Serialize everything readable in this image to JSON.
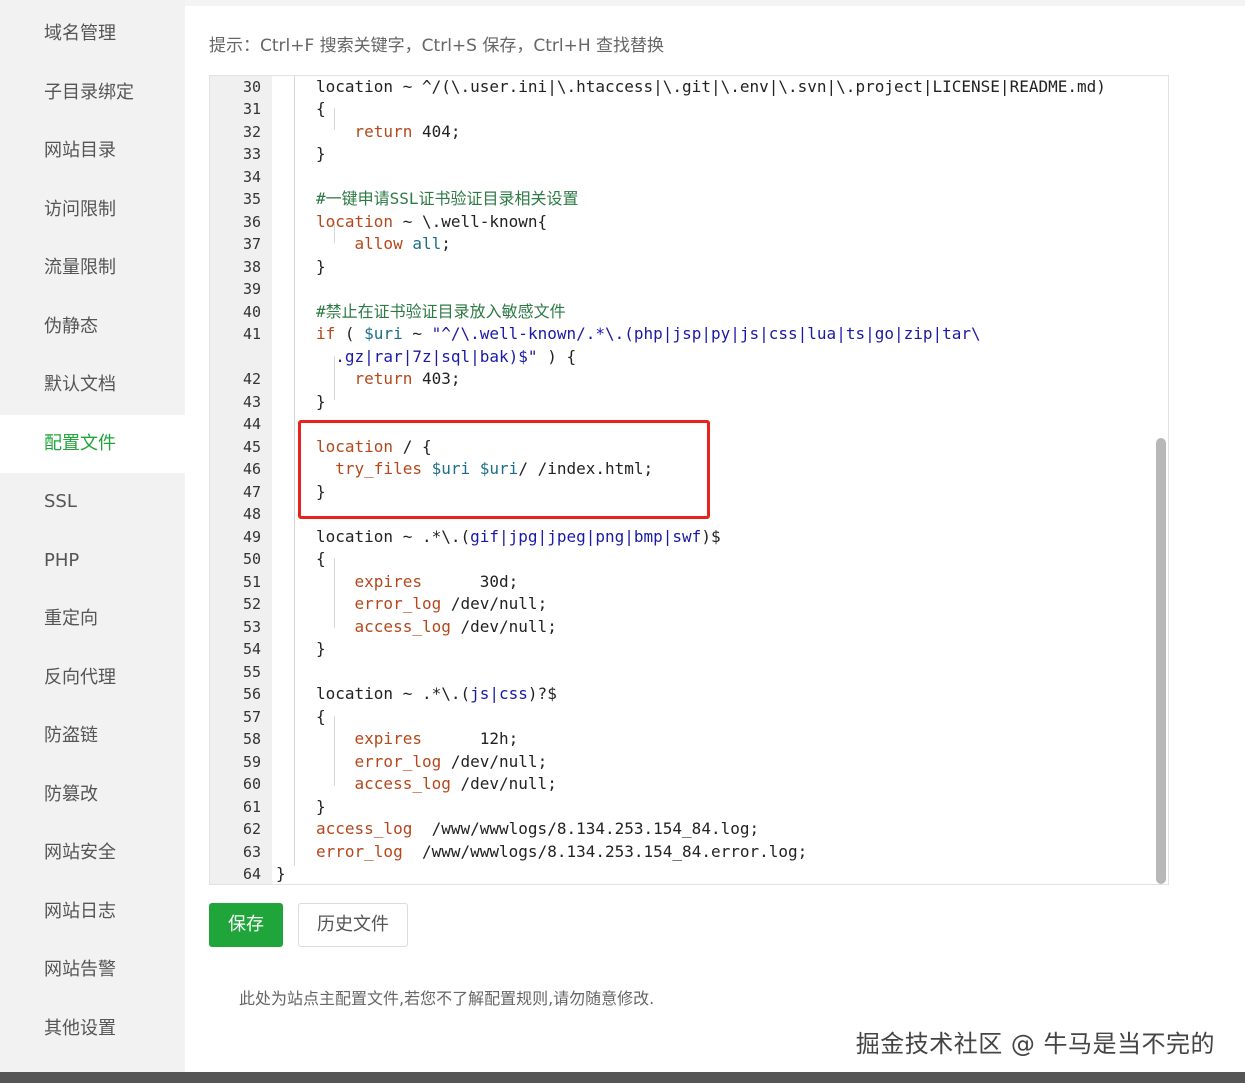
{
  "sidebar": {
    "items": [
      {
        "label": "域名管理"
      },
      {
        "label": "子目录绑定"
      },
      {
        "label": "网站目录"
      },
      {
        "label": "访问限制"
      },
      {
        "label": "流量限制"
      },
      {
        "label": "伪静态"
      },
      {
        "label": "默认文档"
      },
      {
        "label": "配置文件",
        "active": true
      },
      {
        "label": "SSL"
      },
      {
        "label": "PHP"
      },
      {
        "label": "重定向"
      },
      {
        "label": "反向代理"
      },
      {
        "label": "防盗链"
      },
      {
        "label": "防篡改"
      },
      {
        "label": "网站安全"
      },
      {
        "label": "网站日志"
      },
      {
        "label": "网站告警"
      },
      {
        "label": "其他设置"
      }
    ]
  },
  "hint": "提示：Ctrl+F 搜索关键字，Ctrl+S 保存，Ctrl+H 查找替换",
  "editor": {
    "lines": [
      {
        "n": "30",
        "code": [
          [
            "plain",
            "location ~ ^/(\\.user.ini|\\.htaccess|\\.git|\\.env|\\.svn|\\.project|LICENSE|README.md)"
          ]
        ]
      },
      {
        "n": "31",
        "code": [
          [
            "plain",
            "{"
          ]
        ]
      },
      {
        "n": "32",
        "code": [
          [
            "plain",
            "    "
          ],
          [
            "kw",
            "return"
          ],
          [
            "plain",
            " 404;"
          ]
        ]
      },
      {
        "n": "33",
        "code": [
          [
            "plain",
            "}"
          ]
        ]
      },
      {
        "n": "34",
        "code": []
      },
      {
        "n": "35",
        "code": [
          [
            "cm",
            "#一键申请SSL证书验证目录相关设置"
          ]
        ]
      },
      {
        "n": "36",
        "code": [
          [
            "kw",
            "location"
          ],
          [
            "plain",
            " ~ \\.well-known{"
          ]
        ]
      },
      {
        "n": "37",
        "code": [
          [
            "plain",
            "    "
          ],
          [
            "kw",
            "allow"
          ],
          [
            "plain",
            " "
          ],
          [
            "var",
            "all"
          ],
          [
            "plain",
            ";"
          ]
        ]
      },
      {
        "n": "38",
        "code": [
          [
            "plain",
            "}"
          ]
        ]
      },
      {
        "n": "39",
        "code": []
      },
      {
        "n": "40",
        "code": [
          [
            "cm",
            "#禁止在证书验证目录放入敏感文件"
          ]
        ]
      },
      {
        "n": "41",
        "code": [
          [
            "kw",
            "if"
          ],
          [
            "plain",
            " ( "
          ],
          [
            "var",
            "$uri"
          ],
          [
            "plain",
            " ~ "
          ],
          [
            "str",
            "\"^/\\.well-known/.*\\.(php|jsp|py|js|css|lua|ts|go|zip|tar\\"
          ]
        ]
      },
      {
        "n": "",
        "code": [
          [
            "str",
            "  .gz|rar|7z|sql|bak)$\""
          ],
          [
            "plain",
            " ) {"
          ]
        ]
      },
      {
        "n": "42",
        "code": [
          [
            "plain",
            "    "
          ],
          [
            "kw",
            "return"
          ],
          [
            "plain",
            " 403;"
          ]
        ]
      },
      {
        "n": "43",
        "code": [
          [
            "plain",
            "}"
          ]
        ]
      },
      {
        "n": "44",
        "code": []
      },
      {
        "n": "45",
        "code": [
          [
            "kw",
            "location"
          ],
          [
            "plain",
            " / {"
          ]
        ]
      },
      {
        "n": "46",
        "code": [
          [
            "plain",
            "  "
          ],
          [
            "kw",
            "try_files"
          ],
          [
            "plain",
            " "
          ],
          [
            "var",
            "$uri"
          ],
          [
            "plain",
            " "
          ],
          [
            "var",
            "$uri"
          ],
          [
            "plain",
            "/ /index.html;"
          ]
        ]
      },
      {
        "n": "47",
        "code": [
          [
            "plain",
            "}"
          ]
        ]
      },
      {
        "n": "48",
        "code": []
      },
      {
        "n": "49",
        "code": [
          [
            "plain",
            "location ~ .*\\.("
          ],
          [
            "str",
            "gif|jpg|jpeg|png|bmp|swf"
          ],
          [
            "plain",
            ")$"
          ]
        ]
      },
      {
        "n": "50",
        "code": [
          [
            "plain",
            "{"
          ]
        ]
      },
      {
        "n": "51",
        "code": [
          [
            "plain",
            "    "
          ],
          [
            "kw",
            "expires"
          ],
          [
            "plain",
            "      30d;"
          ]
        ]
      },
      {
        "n": "52",
        "code": [
          [
            "plain",
            "    "
          ],
          [
            "kw",
            "error_log"
          ],
          [
            "plain",
            " /dev/null;"
          ]
        ]
      },
      {
        "n": "53",
        "code": [
          [
            "plain",
            "    "
          ],
          [
            "kw",
            "access_log"
          ],
          [
            "plain",
            " /dev/null;"
          ]
        ]
      },
      {
        "n": "54",
        "code": [
          [
            "plain",
            "}"
          ]
        ]
      },
      {
        "n": "55",
        "code": []
      },
      {
        "n": "56",
        "code": [
          [
            "plain",
            "location ~ .*\\.("
          ],
          [
            "str",
            "js|css"
          ],
          [
            "plain",
            ")?$"
          ]
        ]
      },
      {
        "n": "57",
        "code": [
          [
            "plain",
            "{"
          ]
        ]
      },
      {
        "n": "58",
        "code": [
          [
            "plain",
            "    "
          ],
          [
            "kw",
            "expires"
          ],
          [
            "plain",
            "      12h;"
          ]
        ]
      },
      {
        "n": "59",
        "code": [
          [
            "plain",
            "    "
          ],
          [
            "kw",
            "error_log"
          ],
          [
            "plain",
            " /dev/null;"
          ]
        ]
      },
      {
        "n": "60",
        "code": [
          [
            "plain",
            "    "
          ],
          [
            "kw",
            "access_log"
          ],
          [
            "plain",
            " /dev/null;"
          ]
        ]
      },
      {
        "n": "61",
        "code": [
          [
            "plain",
            "}"
          ]
        ]
      },
      {
        "n": "62",
        "code": [
          [
            "kw",
            "access_log"
          ],
          [
            "plain",
            "  /www/wwwlogs/8.134.253.154_84.log;"
          ]
        ]
      },
      {
        "n": "63",
        "code": [
          [
            "kw",
            "error_log"
          ],
          [
            "plain",
            "  /www/wwwlogs/8.134.253.154_84.error.log;"
          ]
        ]
      },
      {
        "n": "64",
        "code": [
          [
            "outer",
            "}"
          ]
        ]
      }
    ]
  },
  "buttons": {
    "save": "保存",
    "history": "历史文件"
  },
  "note": "此处为站点主配置文件,若您不了解配置规则,请勿随意修改.",
  "watermark": "掘金技术社区 @ 牛马是当不完的",
  "colors": {
    "accent": "#20a53a",
    "highlight": "#e8231f"
  }
}
